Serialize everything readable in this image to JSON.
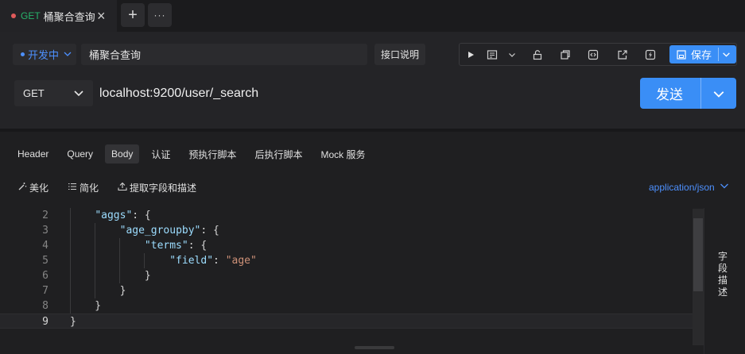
{
  "tab": {
    "method": "GET",
    "title": "桶聚合查询",
    "close": "×"
  },
  "tabbar": {
    "add": "+",
    "more": "···"
  },
  "toolbar": {
    "status": "开发中",
    "name": "桶聚合查询",
    "doc_button": "接口说明",
    "save_label": "保存"
  },
  "request": {
    "method": "GET",
    "url": "localhost:9200/user/_search",
    "send_label": "发送"
  },
  "subtabs": [
    "Header",
    "Query",
    "Body",
    "认证",
    "预执行脚本",
    "后执行脚本",
    "Mock 服务"
  ],
  "body_actions": {
    "beautify": "美化",
    "simplify": "简化",
    "extract": "提取字段和描述"
  },
  "content_type": "application/json",
  "editor": {
    "line_numbers": [
      "2",
      "3",
      "4",
      "5",
      "6",
      "7",
      "8",
      "9"
    ],
    "current_line": "9"
  },
  "side_panel": {
    "label": "字段描述"
  },
  "colors": {
    "accent": "#3a8ef6",
    "get_method": "#27b36b",
    "dirty_dot": "#e05a5a"
  }
}
